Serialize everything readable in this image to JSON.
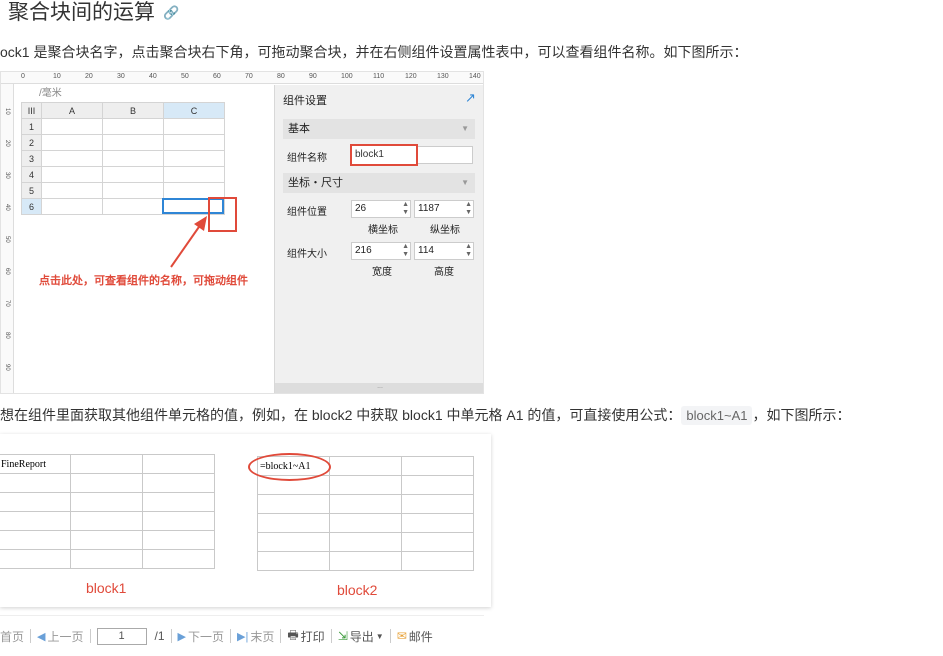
{
  "heading": {
    "title": "聚合块间的运算",
    "link_icon": "link-icon"
  },
  "para1": {
    "text": "ock1 是聚合块名字，点击聚合块右下角，可拖动聚合块，并在右侧组件设置属性表中，可以查看组件名称。如下图所示："
  },
  "fig1": {
    "ruler_top": [
      "0",
      "10",
      "20",
      "30",
      "40",
      "50",
      "60",
      "70",
      "80",
      "90",
      "100",
      "110",
      "120",
      "130",
      "140"
    ],
    "ruler_left": [
      "10",
      "20",
      "30",
      "40",
      "50",
      "60",
      "70",
      "80",
      "90"
    ],
    "unit_label": "/毫米",
    "sheet": {
      "corner": "III",
      "cols": [
        "A",
        "B",
        "C"
      ],
      "rows": [
        "1",
        "2",
        "3",
        "4",
        "5",
        "6"
      ]
    },
    "annotation": "点击此处，可查看组件的名称，可拖动组件",
    "panel": {
      "title": "组件设置",
      "section_basic": "基本",
      "name_label": "组件名称",
      "name_value": "block1",
      "section_coord": "坐标・尺寸",
      "position_label": "组件位置",
      "pos_x": "26",
      "pos_y": "1187",
      "pos_x_label": "横坐标",
      "pos_y_label": "纵坐标",
      "size_label": "组件大小",
      "width": "216",
      "height": "114",
      "width_label": "宽度",
      "height_label": "高度",
      "footer": "..."
    }
  },
  "para2": {
    "before": "想在组件里面获取其他组件单元格的值，例如，在 block2 中获取 block1 中单元格 A1 的值，可直接使用公式：",
    "code": "block1~A1",
    "after": "，如下图所示："
  },
  "fig2": {
    "cell_a1": "FineReport",
    "formula": "=block1~A1",
    "label1": "block1",
    "label2": "block2"
  },
  "toolbar": {
    "first": "首页",
    "prev": "上一页",
    "page_value": "1",
    "page_total": "/1",
    "next": "下一页",
    "last": "末页",
    "print": "打印",
    "export": "导出",
    "mail": "邮件"
  }
}
